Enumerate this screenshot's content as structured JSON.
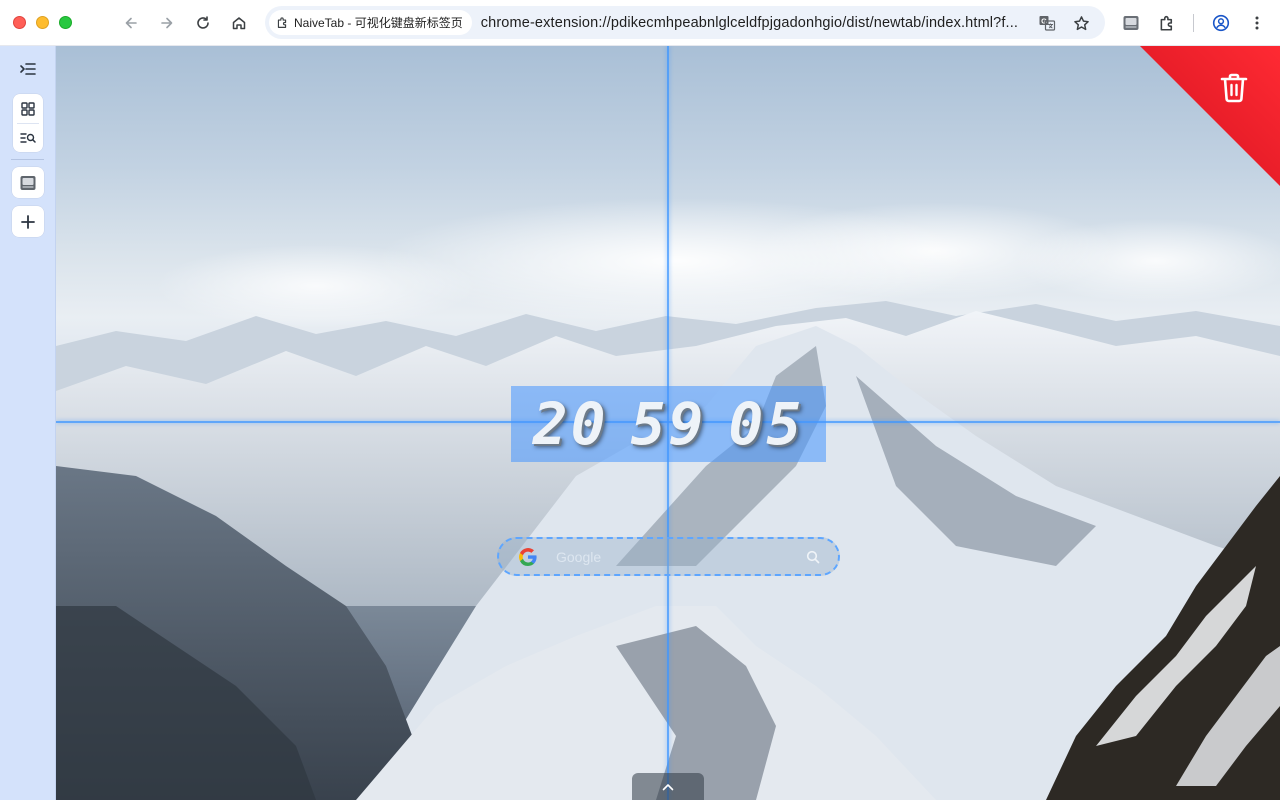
{
  "window": {
    "traffic_lights": [
      "close",
      "minimize",
      "maximize"
    ]
  },
  "toolbar": {
    "back_icon": "arrow-left-icon",
    "forward_icon": "arrow-right-icon",
    "reload_icon": "reload-icon",
    "home_icon": "home-icon"
  },
  "omnibox": {
    "site_chip_label": "NaiveTab - 可视化键盘新标签页",
    "url": "chrome-extension://pdikecmhpeabnlglceldfpjgadonhgio/dist/newtab/index.html?f...",
    "translate_icon": "translate-icon",
    "bookmark_icon": "star-icon"
  },
  "toolbar_right": {
    "extension_icon": "naivetab-extension-icon",
    "extensions_icon": "puzzle-icon",
    "profile_icon": "profile-icon",
    "menu_icon": "kebab-menu-icon"
  },
  "sidebar": {
    "toggle_icon": "collapse-sidebar-icon",
    "items": [
      {
        "name": "grid-view",
        "icon": "grid-icon"
      },
      {
        "name": "search-list",
        "icon": "list-search-icon"
      },
      {
        "name": "naivetab",
        "icon": "naivetab-icon"
      },
      {
        "name": "add",
        "icon": "plus-icon"
      }
    ]
  },
  "clock": {
    "hours": "20",
    "minutes": "59",
    "seconds": "05"
  },
  "search": {
    "engine": "Google",
    "placeholder": "Google"
  },
  "colors": {
    "guide_line": "#3e96ff",
    "trash_corner": "#e3202e",
    "sidebar_bg": "#d4e2fb"
  }
}
